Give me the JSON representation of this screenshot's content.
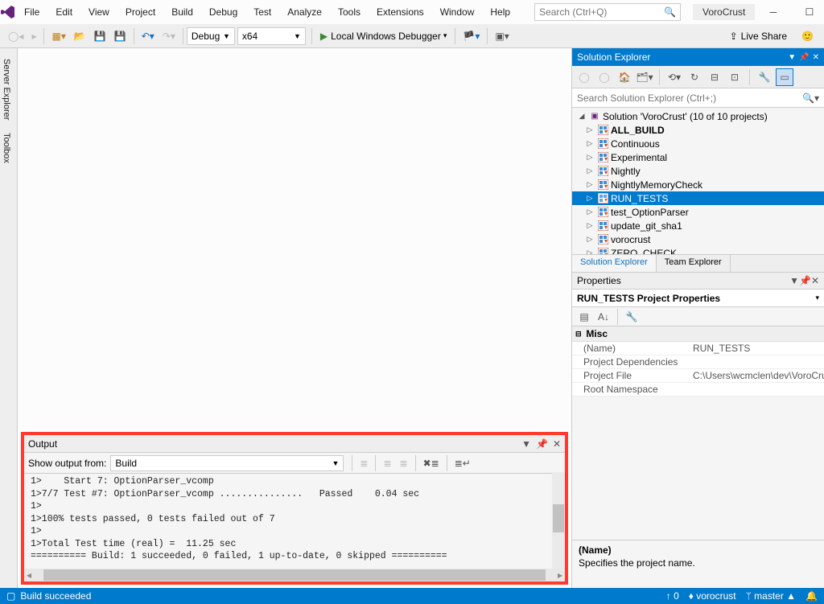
{
  "menu": [
    "File",
    "Edit",
    "View",
    "Project",
    "Build",
    "Debug",
    "Test",
    "Analyze",
    "Tools",
    "Extensions",
    "Window",
    "Help"
  ],
  "search_placeholder": "Search (Ctrl+Q)",
  "project_name": "VoroCrust",
  "toolbar": {
    "config": "Debug",
    "platform": "x64",
    "start_label": "Local Windows Debugger"
  },
  "liveshare": "Live Share",
  "side_tabs": [
    "Server Explorer",
    "Toolbox"
  ],
  "output": {
    "title": "Output",
    "show_from_label": "Show output from:",
    "show_from_value": "Build",
    "text": "1>    Start 7: OptionParser_vcomp\n1>7/7 Test #7: OptionParser_vcomp ...............   Passed    0.04 sec\n1>\n1>100% tests passed, 0 tests failed out of 7\n1>\n1>Total Test time (real) =  11.25 sec\n========== Build: 1 succeeded, 0 failed, 1 up-to-date, 0 skipped =========="
  },
  "solution_explorer": {
    "title": "Solution Explorer",
    "search_placeholder": "Search Solution Explorer (Ctrl+;)",
    "solution_label": "Solution 'VoroCrust' (10 of 10 projects)",
    "projects": [
      {
        "name": "ALL_BUILD",
        "bold": true
      },
      {
        "name": "Continuous"
      },
      {
        "name": "Experimental"
      },
      {
        "name": "Nightly"
      },
      {
        "name": "NightlyMemoryCheck"
      },
      {
        "name": "RUN_TESTS",
        "selected": true
      },
      {
        "name": "test_OptionParser"
      },
      {
        "name": "update_git_sha1"
      },
      {
        "name": "vorocrust"
      },
      {
        "name": "ZERO_CHECK"
      }
    ],
    "tabs": [
      "Solution Explorer",
      "Team Explorer"
    ]
  },
  "properties": {
    "title": "Properties",
    "subject": "RUN_TESTS Project Properties",
    "category": "Misc",
    "rows": [
      {
        "name": "(Name)",
        "value": "RUN_TESTS"
      },
      {
        "name": "Project Dependencies",
        "value": ""
      },
      {
        "name": "Project File",
        "value": "C:\\Users\\wcmclen\\dev\\VoroCrust\\vc"
      },
      {
        "name": "Root Namespace",
        "value": ""
      }
    ],
    "desc_name": "(Name)",
    "desc_text": "Specifies the project name."
  },
  "status": {
    "left": "Build succeeded",
    "items": [
      "↑ 0",
      "vorocrust",
      "master ▲"
    ]
  }
}
